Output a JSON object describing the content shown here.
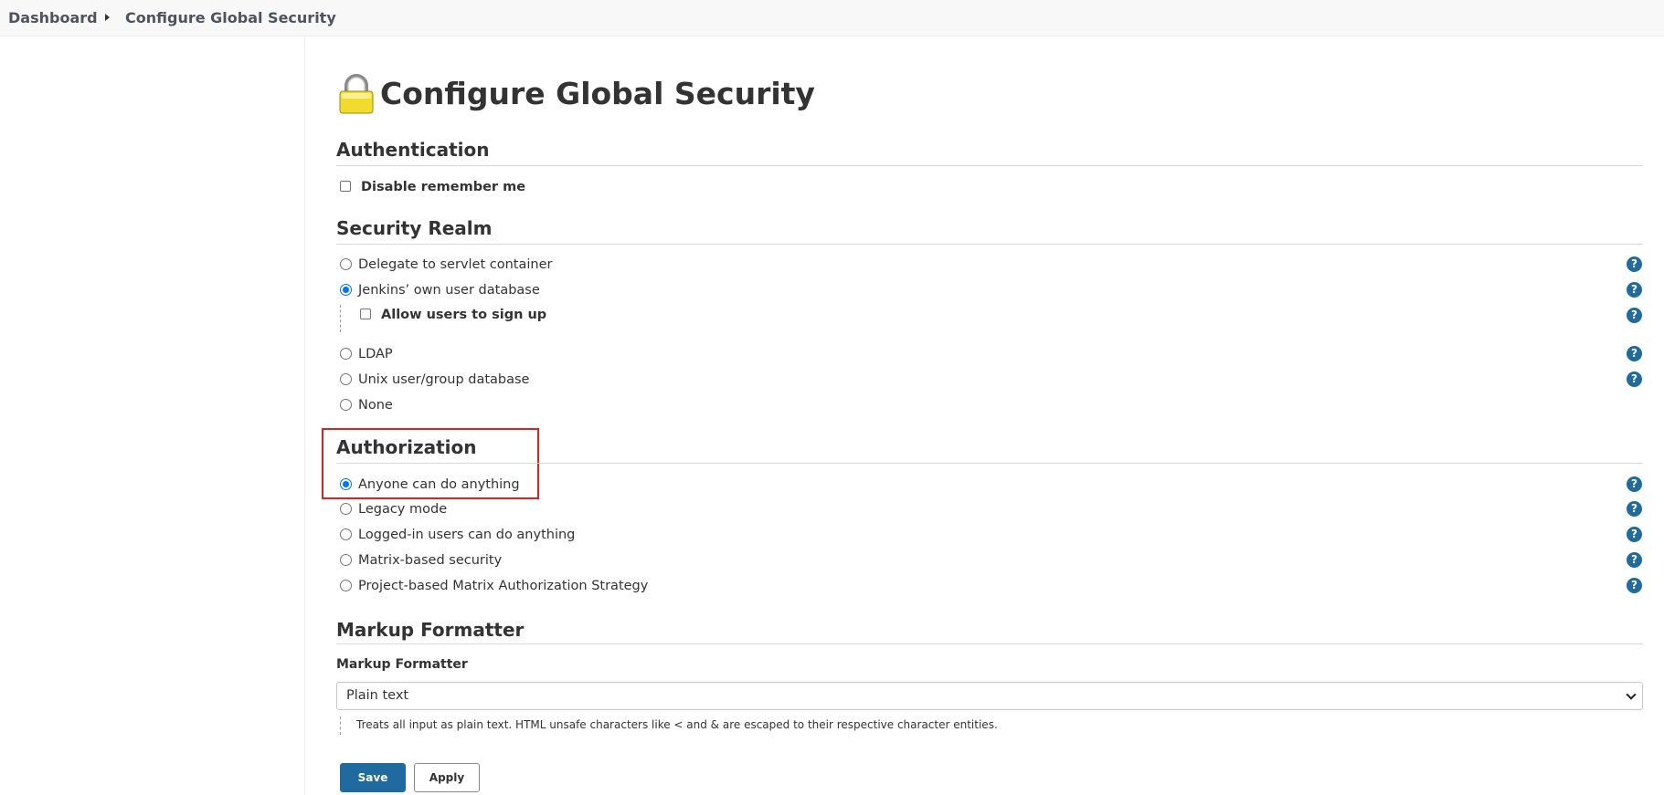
{
  "breadcrumb": {
    "items": [
      "Dashboard",
      "Configure Global Security"
    ]
  },
  "page": {
    "title": "Configure Global Security"
  },
  "authentication": {
    "title": "Authentication",
    "disable_remember_me": {
      "label": "Disable remember me",
      "checked": false
    }
  },
  "security_realm": {
    "title": "Security Realm",
    "options": [
      {
        "label": "Delegate to servlet container",
        "checked": false
      },
      {
        "label": "Jenkins’ own user database",
        "checked": true
      },
      {
        "label": "LDAP",
        "checked": false
      },
      {
        "label": "Unix user/group database",
        "checked": false
      },
      {
        "label": "None",
        "checked": false
      }
    ],
    "allow_signup": {
      "label": "Allow users to sign up",
      "checked": false
    }
  },
  "authorization": {
    "title": "Authorization",
    "options": [
      {
        "label": "Anyone can do anything",
        "checked": true
      },
      {
        "label": "Legacy mode",
        "checked": false
      },
      {
        "label": "Logged-in users can do anything",
        "checked": false
      },
      {
        "label": "Matrix-based security",
        "checked": false
      },
      {
        "label": "Project-based Matrix Authorization Strategy",
        "checked": false
      }
    ]
  },
  "markup_formatter": {
    "title": "Markup Formatter",
    "field_label": "Markup Formatter",
    "selected": "Plain text",
    "description": "Treats all input as plain text. HTML unsafe characters like < and & are escaped to their respective character entities."
  },
  "buttons": {
    "save": "Save",
    "apply": "Apply"
  },
  "help_icon_glyph": "?",
  "colors": {
    "accent": "#1f6ba0",
    "highlight": "#e0201d",
    "radio_checked": "#0075ff"
  }
}
